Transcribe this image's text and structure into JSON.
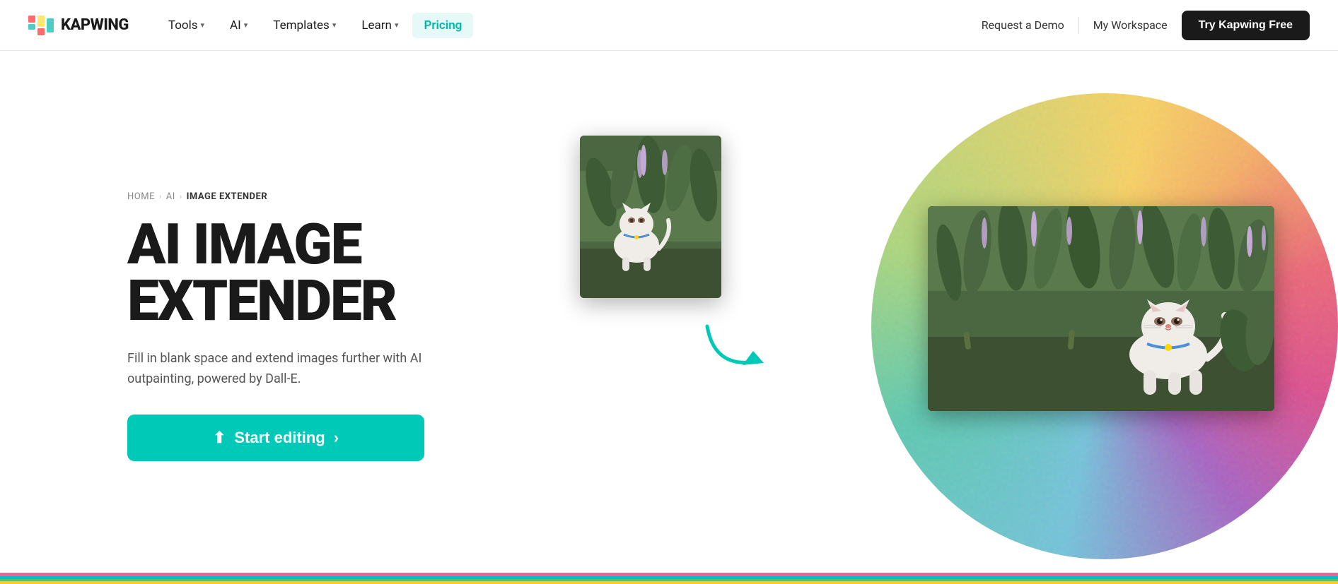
{
  "nav": {
    "logo_text": "KAPWING",
    "links": [
      {
        "label": "Tools",
        "has_dropdown": true,
        "active": false
      },
      {
        "label": "AI",
        "has_dropdown": true,
        "active": false
      },
      {
        "label": "Templates",
        "has_dropdown": true,
        "active": false
      },
      {
        "label": "Learn",
        "has_dropdown": true,
        "active": false
      },
      {
        "label": "Pricing",
        "has_dropdown": false,
        "active": true
      }
    ],
    "request_demo": "Request a Demo",
    "my_workspace": "My Workspace",
    "cta": "Try Kapwing Free"
  },
  "breadcrumb": {
    "home": "HOME",
    "ai": "AI",
    "current": "IMAGE EXTENDER"
  },
  "hero": {
    "title_line1": "AI IMAGE",
    "title_line2": "EXTENDER",
    "description": "Fill in blank space and extend images further with AI outpainting, powered by Dall-E.",
    "cta_label": "Start editing",
    "cta_chevron": "›"
  },
  "bottom_bars": {
    "colors": [
      "#f06292",
      "#00bcd4",
      "#66bb6a",
      "#ffca28",
      "#f06292"
    ]
  },
  "colors": {
    "cta_bg": "#00c9b7",
    "nav_cta_bg": "#1a1a1a",
    "breadcrumb_text": "#888888",
    "title_color": "#1a1a1a",
    "desc_color": "#555555"
  }
}
